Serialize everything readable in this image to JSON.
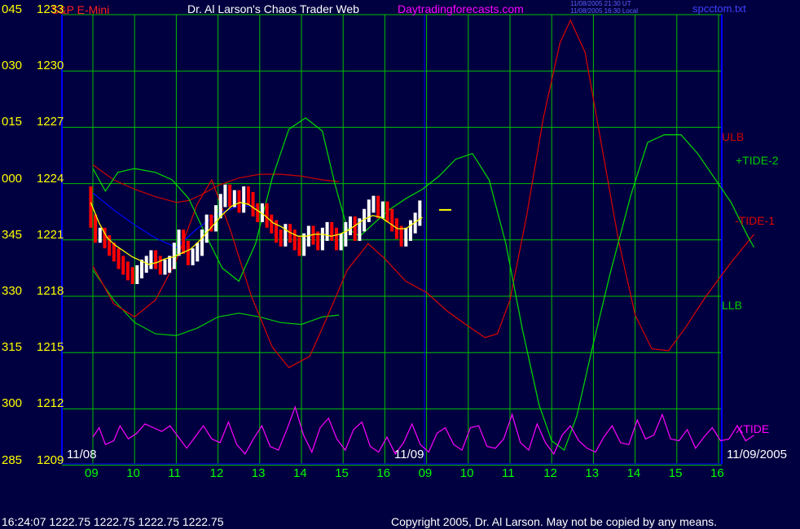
{
  "header": {
    "instrument": "S&P E-Mini",
    "title": "Dr. Al Larson's Chaos Trader Web",
    "site": "Daytradingforecasts.com",
    "timestamp_ut": "11/08/2005 21:30 UT",
    "timestamp_local": "11/08/2005 16:30 Local",
    "file": "spcctom.txt"
  },
  "footer": {
    "quote": "16:24:07   1222.75  1222.75  1222.75  1222.75",
    "copyright": "Copyright 2005, Dr. Al Larson. May not be copied by any means."
  },
  "colors": {
    "background": "#000040",
    "grid": "#00c000",
    "axis": "#0000ff",
    "price_up": "#ffffff",
    "price_down": "#ff0000",
    "average": "#ffff00",
    "blue_line": "#0000ff",
    "ulb": "#cc0000",
    "llb": "#00cc00",
    "tide_plus": "#00dd00",
    "tide_minus": "#dd0000",
    "xtide": "#ff00ff"
  },
  "chart_data": {
    "type": "line",
    "y_axis": {
      "range": [
        1209,
        1233
      ],
      "ticks": [
        {
          "v": 1233,
          "price": "1233",
          "angle": "045"
        },
        {
          "v": 1230,
          "price": "1230",
          "angle": "030"
        },
        {
          "v": 1227,
          "price": "1227",
          "angle": "015"
        },
        {
          "v": 1224,
          "price": "1224",
          "angle": "000"
        },
        {
          "v": 1221,
          "price": "1221",
          "angle": "345"
        },
        {
          "v": 1218,
          "price": "1218",
          "angle": "330"
        },
        {
          "v": 1215,
          "price": "1215",
          "angle": "315"
        },
        {
          "v": 1212,
          "price": "1212",
          "angle": "300"
        },
        {
          "v": 1209,
          "price": "1209",
          "angle": "285"
        }
      ]
    },
    "x_axis": {
      "hour_labels": [
        "09",
        "10",
        "11",
        "12",
        "13",
        "14",
        "15",
        "16",
        "09",
        "10",
        "11",
        "12",
        "13",
        "14",
        "15",
        "16"
      ],
      "date_labels": [
        "11/08",
        "11/09",
        "11/09/2005"
      ]
    },
    "series_labels": [
      "ULB",
      "+TIDE-2",
      "-TIDE-1",
      "LLB",
      "XTIDE"
    ],
    "grid": true,
    "series": [
      {
        "name": "ULB",
        "color": "#cc0000",
        "points": [
          [
            0,
            1225
          ],
          [
            0.5,
            1224.2
          ],
          [
            1,
            1223.7
          ],
          [
            1.5,
            1223.3
          ],
          [
            2,
            1223
          ],
          [
            2.3,
            1223.1
          ],
          [
            2.6,
            1223.4
          ],
          [
            3,
            1223.9
          ],
          [
            3.5,
            1224.3
          ],
          [
            4,
            1224.5
          ],
          [
            4.5,
            1224.5
          ],
          [
            5,
            1224.4
          ],
          [
            5.5,
            1224.2
          ],
          [
            5.9,
            1224.1
          ]
        ]
      },
      {
        "name": "LLB",
        "color": "#00cc00",
        "points": [
          [
            0,
            1219.4
          ],
          [
            0.5,
            1217.8
          ],
          [
            1,
            1216.6
          ],
          [
            1.5,
            1216
          ],
          [
            2,
            1215.9
          ],
          [
            2.5,
            1216.3
          ],
          [
            3,
            1216.9
          ],
          [
            3.5,
            1217.1
          ],
          [
            4,
            1216.9
          ],
          [
            4.5,
            1216.6
          ],
          [
            5,
            1216.5
          ],
          [
            5.5,
            1216.9
          ],
          [
            5.9,
            1217
          ]
        ]
      },
      {
        "name": "-TIDE-1",
        "color": "#dd0000",
        "points": [
          [
            0,
            1219.6
          ],
          [
            0.5,
            1217.6
          ],
          [
            1,
            1216.9
          ],
          [
            1.5,
            1217.8
          ],
          [
            2,
            1219.9
          ],
          [
            2.5,
            1222.9
          ],
          [
            2.85,
            1224.2
          ],
          [
            3.3,
            1221.5
          ],
          [
            3.8,
            1218
          ],
          [
            4.3,
            1215.3
          ],
          [
            4.7,
            1214.2
          ],
          [
            5.2,
            1214.8
          ],
          [
            5.6,
            1216.8
          ],
          [
            6.1,
            1219.4
          ],
          [
            6.6,
            1220.8
          ],
          [
            7,
            1220
          ],
          [
            7.5,
            1218.8
          ],
          [
            8,
            1218.2
          ],
          [
            8.5,
            1217.2
          ],
          [
            9,
            1216.4
          ],
          [
            9.4,
            1215.8
          ],
          [
            9.7,
            1216
          ],
          [
            10,
            1217.8
          ],
          [
            10.4,
            1222.3
          ],
          [
            10.8,
            1227.5
          ],
          [
            11.2,
            1231.5
          ],
          [
            11.45,
            1232.7
          ],
          [
            11.8,
            1231
          ],
          [
            12.2,
            1226
          ],
          [
            12.6,
            1221
          ],
          [
            13,
            1217
          ],
          [
            13.4,
            1215.2
          ],
          [
            13.8,
            1215.1
          ],
          [
            14.2,
            1216.3
          ],
          [
            14.7,
            1218
          ],
          [
            15.3,
            1219.8
          ],
          [
            15.85,
            1221.3
          ]
        ]
      },
      {
        "name": "+TIDE-2",
        "color": "#00dd00",
        "points": [
          [
            0,
            1224.8
          ],
          [
            0.3,
            1223.6
          ],
          [
            0.6,
            1224.6
          ],
          [
            1,
            1224.8
          ],
          [
            1.5,
            1224.6
          ],
          [
            1.9,
            1224.2
          ],
          [
            2.3,
            1223.2
          ],
          [
            2.7,
            1221.3
          ],
          [
            3.1,
            1219.5
          ],
          [
            3.5,
            1218.8
          ],
          [
            3.9,
            1220.8
          ],
          [
            4.3,
            1224.3
          ],
          [
            4.7,
            1226.9
          ],
          [
            5.1,
            1227.5
          ],
          [
            5.5,
            1226.8
          ],
          [
            5.8,
            1224
          ],
          [
            6.1,
            1221.6
          ],
          [
            6.4,
            1221.2
          ],
          [
            6.7,
            1221.8
          ],
          [
            7.1,
            1222.6
          ],
          [
            7.5,
            1223.2
          ],
          [
            7.9,
            1223.7
          ],
          [
            8.3,
            1224.4
          ],
          [
            8.7,
            1225.3
          ],
          [
            9.1,
            1225.6
          ],
          [
            9.5,
            1224.2
          ],
          [
            9.9,
            1220.8
          ],
          [
            10.3,
            1216.2
          ],
          [
            10.7,
            1212.2
          ],
          [
            11,
            1210.3
          ],
          [
            11.3,
            1209.8
          ],
          [
            11.6,
            1211.6
          ],
          [
            12,
            1215.5
          ],
          [
            12.4,
            1219.2
          ],
          [
            12.9,
            1223.4
          ],
          [
            13.3,
            1226.2
          ],
          [
            13.7,
            1226.6
          ],
          [
            14.1,
            1226.6
          ],
          [
            14.5,
            1225.6
          ],
          [
            14.9,
            1224.3
          ],
          [
            15.3,
            1223
          ],
          [
            15.7,
            1221.2
          ],
          [
            15.85,
            1220.6
          ]
        ]
      },
      {
        "name": "blue",
        "color": "#0000ff",
        "points": [
          [
            0,
            1223.5
          ],
          [
            0.5,
            1222.6
          ],
          [
            1,
            1221.8
          ],
          [
            1.5,
            1221.1
          ],
          [
            2,
            1220.6
          ],
          [
            2.5,
            1221.6
          ],
          [
            3,
            1222.4
          ],
          [
            3.5,
            1222.8
          ],
          [
            4,
            1222.8
          ]
        ]
      }
    ],
    "xtide_points": [
      [
        0,
        1210.5
      ],
      [
        0.15,
        1211
      ],
      [
        0.3,
        1210.1
      ],
      [
        0.5,
        1210.3
      ],
      [
        0.65,
        1211.1
      ],
      [
        0.85,
        1210.4
      ],
      [
        1.05,
        1210.7
      ],
      [
        1.25,
        1211.2
      ],
      [
        1.45,
        1211
      ],
      [
        1.65,
        1210.8
      ],
      [
        1.85,
        1211.1
      ],
      [
        2.05,
        1210.5
      ],
      [
        2.25,
        1209.9
      ],
      [
        2.45,
        1210.5
      ],
      [
        2.65,
        1211.1
      ],
      [
        2.85,
        1210.4
      ],
      [
        3.05,
        1210.2
      ],
      [
        3.25,
        1211.3
      ],
      [
        3.45,
        1210.1
      ],
      [
        3.65,
        1209.6
      ],
      [
        3.85,
        1210.4
      ],
      [
        4.05,
        1211.1
      ],
      [
        4.25,
        1210
      ],
      [
        4.45,
        1209.8
      ],
      [
        4.65,
        1210.9
      ],
      [
        4.85,
        1212.1
      ],
      [
        5.05,
        1210.6
      ],
      [
        5.25,
        1209.7
      ],
      [
        5.45,
        1211
      ],
      [
        5.65,
        1211.5
      ],
      [
        5.85,
        1210.4
      ],
      [
        6.05,
        1209.8
      ],
      [
        6.25,
        1210.9
      ],
      [
        6.45,
        1211.3
      ],
      [
        6.65,
        1210
      ],
      [
        6.85,
        1209.7
      ],
      [
        7.05,
        1210.5
      ],
      [
        7.25,
        1209.6
      ],
      [
        7.45,
        1210.2
      ],
      [
        7.65,
        1211.2
      ],
      [
        7.85,
        1210.1
      ],
      [
        8.05,
        1209.7
      ],
      [
        8.25,
        1210.7
      ],
      [
        8.45,
        1211
      ],
      [
        8.65,
        1210.1
      ],
      [
        8.85,
        1209.8
      ],
      [
        9.05,
        1211
      ],
      [
        9.25,
        1211.1
      ],
      [
        9.45,
        1210
      ],
      [
        9.65,
        1209.9
      ],
      [
        9.85,
        1210.4
      ],
      [
        10.05,
        1211.7
      ],
      [
        10.25,
        1210.2
      ],
      [
        10.45,
        1209.8
      ],
      [
        10.65,
        1211.2
      ],
      [
        10.85,
        1210.2
      ],
      [
        11.05,
        1209.6
      ],
      [
        11.25,
        1210.6
      ],
      [
        11.45,
        1211.1
      ],
      [
        11.65,
        1210.3
      ],
      [
        11.85,
        1209.9
      ],
      [
        12.05,
        1209.7
      ],
      [
        12.25,
        1210.5
      ],
      [
        12.45,
        1211.1
      ],
      [
        12.65,
        1210.2
      ],
      [
        12.85,
        1210.1
      ],
      [
        13.05,
        1211.4
      ],
      [
        13.25,
        1210.4
      ],
      [
        13.45,
        1210.6
      ],
      [
        13.65,
        1211.7
      ],
      [
        13.85,
        1210.4
      ],
      [
        14.05,
        1210.3
      ],
      [
        14.25,
        1210.9
      ],
      [
        14.45,
        1209.9
      ],
      [
        14.65,
        1210.5
      ],
      [
        14.85,
        1211
      ],
      [
        15.05,
        1210.3
      ],
      [
        15.25,
        1210.4
      ],
      [
        15.45,
        1211.1
      ],
      [
        15.65,
        1210.3
      ],
      [
        15.85,
        1210.6
      ]
    ],
    "price_path": [
      1223.5,
      1222,
      1221.2,
      1221.3,
      1220.9,
      1220.5,
      1220.2,
      1219.8,
      1219.5,
      1219.2,
      1219,
      1219.3,
      1219.6,
      1219.8,
      1220.1,
      1219.8,
      1219.5,
      1219.6,
      1219.8,
      1220.5,
      1221.2,
      1220.6,
      1220,
      1220.2,
      1220.5,
      1221.2,
      1222,
      1221.8,
      1222.5,
      1223.1,
      1223.6,
      1223.1,
      1223.3,
      1222.8,
      1223.5,
      1223.2,
      1222.6,
      1222.3,
      1222.6,
      1222,
      1221.7,
      1221.2,
      1221,
      1221.5,
      1221.2,
      1220.8,
      1220.5,
      1221,
      1221.4,
      1221.1,
      1220.8,
      1221.3,
      1221.6,
      1221.3,
      1220.8,
      1221,
      1221.6,
      1221.9,
      1221.3,
      1221.8,
      1222.3,
      1222.8,
      1223,
      1222.5,
      1222.7,
      1222.3,
      1221.8,
      1221.4,
      1221,
      1221.3,
      1221.7,
      1222.1,
      1222.75
    ],
    "average_path": [
      1223,
      1221.9,
      1221.1,
      1220.7,
      1220.4,
      1220.1,
      1219.9,
      1219.7,
      1219.8,
      1220,
      1220.1,
      1220.3,
      1220.5,
      1220.9,
      1221.4,
      1221.9,
      1222.4,
      1222.8,
      1223,
      1222.9,
      1222.6,
      1222.3,
      1221.9,
      1221.7,
      1221.4,
      1221.2,
      1221.2,
      1221.3,
      1221.3,
      1221.2,
      1221.3,
      1221.5,
      1221.8,
      1222.1,
      1222.3,
      1222.2,
      1221.9,
      1221.6,
      1221.6,
      1221.9,
      1222.2
    ],
    "tick_mark": {
      "x": 8.3,
      "y": 1222.6
    }
  }
}
